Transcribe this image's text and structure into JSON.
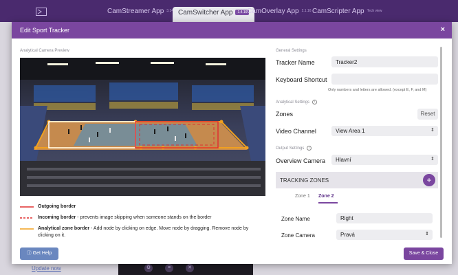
{
  "appbar": {
    "tabs": [
      {
        "label": "CamStreamer App",
        "version": "3.14.14"
      },
      {
        "label": "CamSwitcher App",
        "version": "1.4.16"
      },
      {
        "label": "CamOverlay App",
        "version": "2.1.16"
      },
      {
        "label": "CamScripter App",
        "version": "Tech view"
      }
    ]
  },
  "background": {
    "link": "Update now"
  },
  "modal": {
    "title": "Edit Sport Tracker",
    "close": "×",
    "preview_label": "Analytical Camera Preview",
    "legend": [
      {
        "title": "Outgoing border",
        "desc": "",
        "color": "#e03030"
      },
      {
        "title": "Incoming border",
        "desc": " - prevents image skipping when someone stands on the border",
        "color": "#e03030"
      },
      {
        "title": "Analytical zone border",
        "desc": " - Add node by clicking on edge. Move node by dragging. Remove node by clicking on it.",
        "color": "#f2a11f"
      }
    ],
    "general_settings": "General Settings",
    "tracker_name_label": "Tracker Name",
    "tracker_name_value": "Tracker2",
    "keyboard_label": "Keyboard Shortcut",
    "keyboard_value": "",
    "keyboard_hint": "Only numbers and letters are allowed. (except E, F, and M)",
    "analytical_settings": "Analytical Settings",
    "zones_label": "Zones",
    "reset_label": "Reset",
    "video_channel_label": "Video Channel",
    "video_channel_value": "View Area 1",
    "output_settings": "Output Settings",
    "overview_label": "Overview Camera",
    "overview_value": "Hlavní",
    "tracking_zones_title": "TRACKING ZONES",
    "add_symbol": "+",
    "zone_tabs": [
      "Zone 1",
      "Zone 2"
    ],
    "zone_name_label": "Zone Name",
    "zone_name_value": "Right",
    "zone_camera_label": "Zone Camera",
    "zone_camera_value": "Pravá",
    "help_label": "Get Help",
    "save_label": "Save & Close"
  },
  "colors": {
    "accent": "#7a469f",
    "appbar": "#4a2a6e",
    "help": "#6a87bf"
  }
}
